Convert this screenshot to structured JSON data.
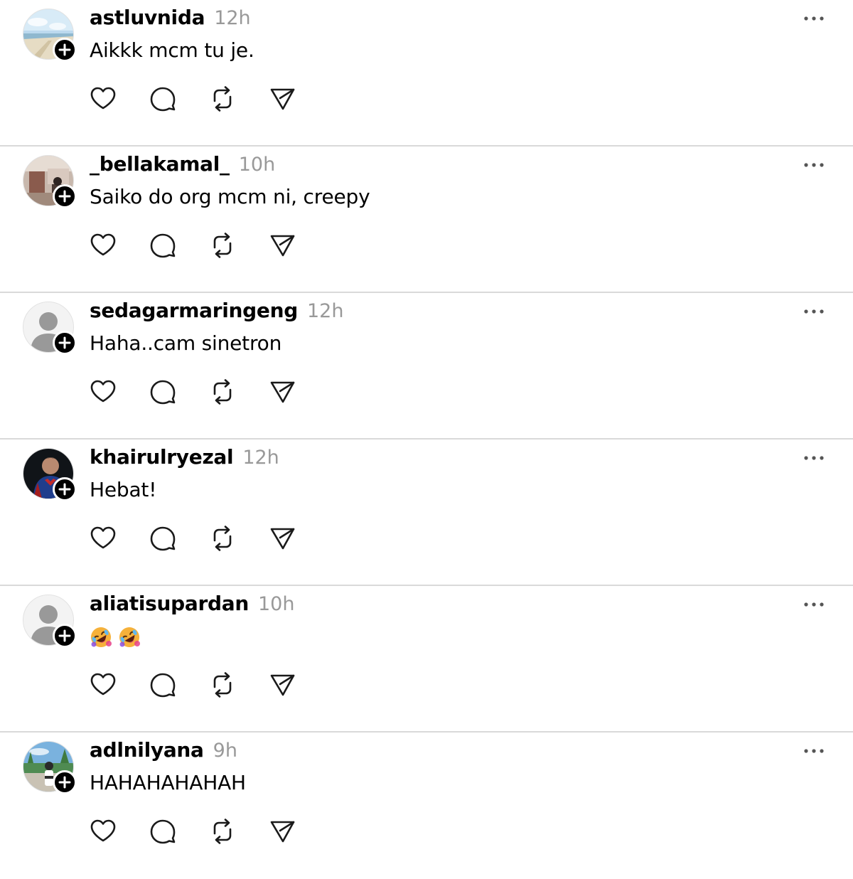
{
  "posts": [
    {
      "username": "astluvnida",
      "time": "12h",
      "text": "Aikkk mcm tu je.",
      "avatar": "beach-photo"
    },
    {
      "username": "_bellakamal_",
      "time": "10h",
      "text": "Saiko do org mcm ni, creepy",
      "avatar": "room-photo"
    },
    {
      "username": "sedagarmaringeng",
      "time": "12h",
      "text": "Haha..cam sinetron",
      "avatar": "default-silhouette"
    },
    {
      "username": "khairulryezal",
      "time": "12h",
      "text": "Hebat!",
      "avatar": "superhero-photo"
    },
    {
      "username": "aliatisupardan",
      "time": "10h",
      "text": "",
      "emojis": [
        "rolling-on-floor-laughing-emoji",
        "rolling-on-floor-laughing-emoji"
      ],
      "avatar": "default-silhouette"
    },
    {
      "username": "adlnilyana",
      "time": "9h",
      "text": "HAHAHAHAHAH",
      "avatar": "outdoor-photo"
    }
  ],
  "icons": {
    "follow": "plus-icon",
    "more": "more-horizontal-icon",
    "like": "heart-icon",
    "reply": "comment-icon",
    "repost": "repost-icon",
    "share": "send-icon"
  },
  "colors": {
    "text": "#000000",
    "muted": "#999999",
    "divider": "#d9d9d9",
    "icon": "#1a1a1a"
  }
}
